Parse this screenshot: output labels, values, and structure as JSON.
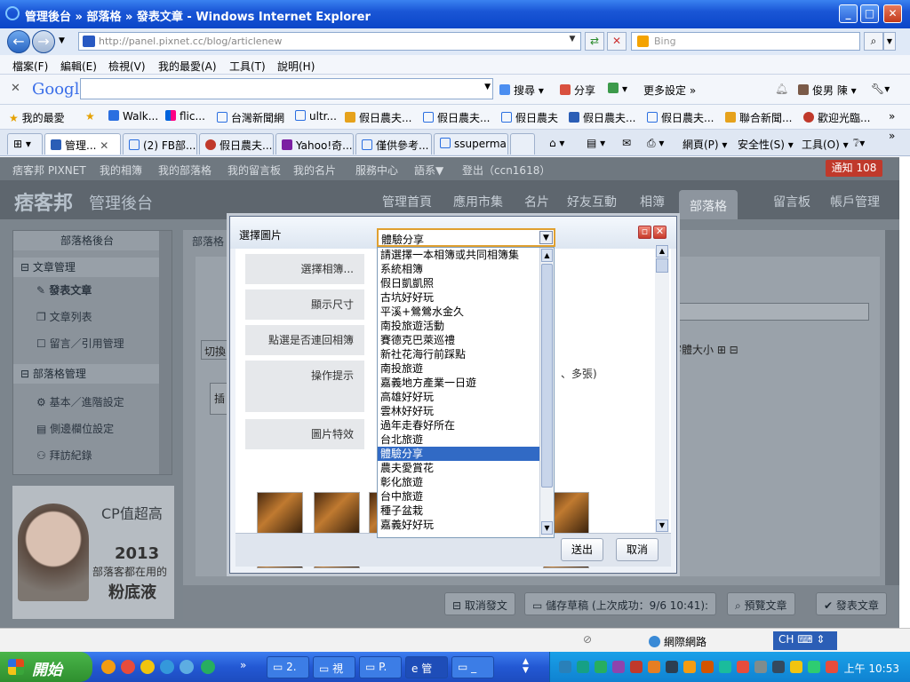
{
  "window": {
    "title": "管理後台 » 部落格 » 發表文章 - Windows Internet Explorer"
  },
  "address": {
    "url": "http://panel.pixnet.cc/blog/articlenew",
    "search_placeholder": "Bing"
  },
  "menu": [
    "檔案(F)",
    "編輯(E)",
    "檢視(V)",
    "我的最愛(A)",
    "工具(T)",
    "說明(H)"
  ],
  "google_toolbar": {
    "logo": "Google",
    "search": "搜尋",
    "share": "分享",
    "more": "更多設定 »",
    "user": "俊男 陳"
  },
  "favorites": {
    "label": "我的最愛",
    "items": [
      "Walk...",
      "flic...",
      "台灣新聞網",
      "ultr...",
      "假日農夫...",
      "假日農夫...",
      "假日農夫",
      "假日農夫...",
      "假日農夫...",
      "聯合新聞...",
      "歡迎光臨..."
    ]
  },
  "tabs": [
    "管理...",
    "(2) FB部...",
    "假日農夫...",
    "Yahoo!奇...",
    "僅供參考...",
    "ssuperma..."
  ],
  "command_bar": {
    "page": "網頁(P)",
    "safety": "安全性(S)",
    "tools": "工具(O)"
  },
  "site": {
    "topnav": [
      "痞客邦 PIXNET",
      "我的相簿",
      "我的部落格",
      "我的留言板",
      "我的名片",
      "服務中心",
      "語系▼",
      "登出（ccn1618）"
    ],
    "notice": "通知 108",
    "logo": "痞客邦",
    "admin_title": "管理後台",
    "nav": [
      "管理首頁",
      "應用市集",
      "名片",
      "好友互動",
      "相簿",
      "部落格",
      "留言板",
      "帳戶管理"
    ],
    "sidebar": {
      "header": "部落格後台",
      "section1": "文章管理",
      "items1": [
        "發表文章",
        "文章列表",
        "留言／引用管理"
      ],
      "section2": "部落格管理",
      "items2": [
        "基本／進階設定",
        "側邊欄位設定",
        "拜訪紀錄"
      ]
    },
    "breadcrumb": "部落格",
    "switch_label": "切換",
    "insert_label": "插",
    "font_size": "字體大小 ⊞ ⊟",
    "bottom_tools": {
      "cancel": "取消發文",
      "draft": "儲存草稿 (上次成功：9/6 10:41):",
      "preview": "預覽文章",
      "publish": "發表文章"
    },
    "ad": {
      "line1": "CP值超高",
      "line2": "2013",
      "line3": "部落客都在用的",
      "line4": "粉底液"
    }
  },
  "dialog": {
    "title": "選擇圖片",
    "labels": {
      "album": "選擇相簿...",
      "size": "顯示尺寸",
      "link": "點選是否連回相簿",
      "tips": "操作提示",
      "effect": "圖片特效"
    },
    "tips_tail": "、多張)",
    "selected_album": "體驗分享",
    "album_options": [
      "請選擇一本相簿或共同相簿集",
      "系統相簿",
      "假日凱凱照",
      "古坑好好玩",
      "平溪+鶯鶯水金久",
      "南投旅遊活動",
      "賽德克巴萊巡禮",
      "新社花海行前踩點",
      "南投旅遊",
      "嘉義地方產業一日遊",
      "高雄好好玩",
      "雲林好好玩",
      "過年走春好所在",
      "台北旅遊",
      "體驗分享",
      "農夫愛賞花",
      "彰化旅遊",
      "台中旅遊",
      "種子盆栽",
      "嘉義好好玩"
    ],
    "selected_index": 14,
    "send": "送出",
    "cancel": "取消"
  },
  "status": {
    "network": "網際網路",
    "ime": "CH"
  },
  "taskbar": {
    "start": "開始",
    "buttons": [
      "2.",
      "視",
      "P.",
      "管",
      "_"
    ],
    "clock": "上午 10:53"
  }
}
